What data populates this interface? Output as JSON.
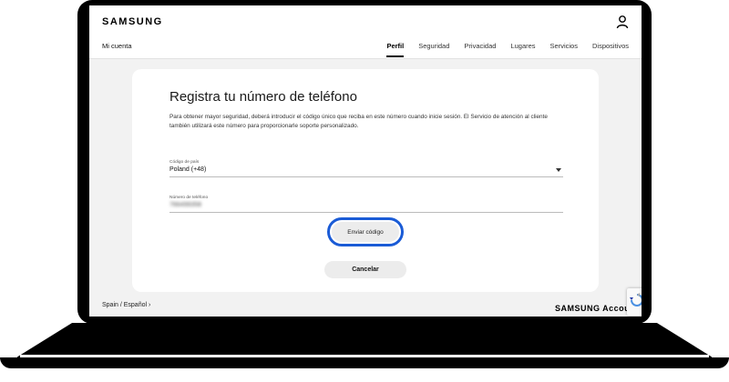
{
  "header": {
    "logo": "SAMSUNG",
    "account_label": "Mi cuenta",
    "nav": [
      {
        "label": "Perfil",
        "active": true
      },
      {
        "label": "Seguridad",
        "active": false
      },
      {
        "label": "Privacidad",
        "active": false
      },
      {
        "label": "Lugares",
        "active": false
      },
      {
        "label": "Servicios",
        "active": false
      },
      {
        "label": "Dispositivos",
        "active": false
      }
    ]
  },
  "card": {
    "title": "Registra tu número de teléfono",
    "description": "Para obtener mayor seguridad, deberá introducir el código único que reciba en este número cuando inicie sesión. El Servicio de atención al cliente también utilizará este número para proporcionarle soporte personalizado.",
    "country": {
      "label": "Código de país",
      "value": "Poland (+48)"
    },
    "phone": {
      "label": "Número de teléfono",
      "value": "766499358"
    },
    "send_button": "Enviar código",
    "cancel_button": "Cancelar"
  },
  "footer": {
    "region": "Spain / Español  ›",
    "brand": "SAMSUNG Accoun"
  },
  "colors": {
    "highlight": "#1a5bd6",
    "background": "#f2f2f2"
  }
}
